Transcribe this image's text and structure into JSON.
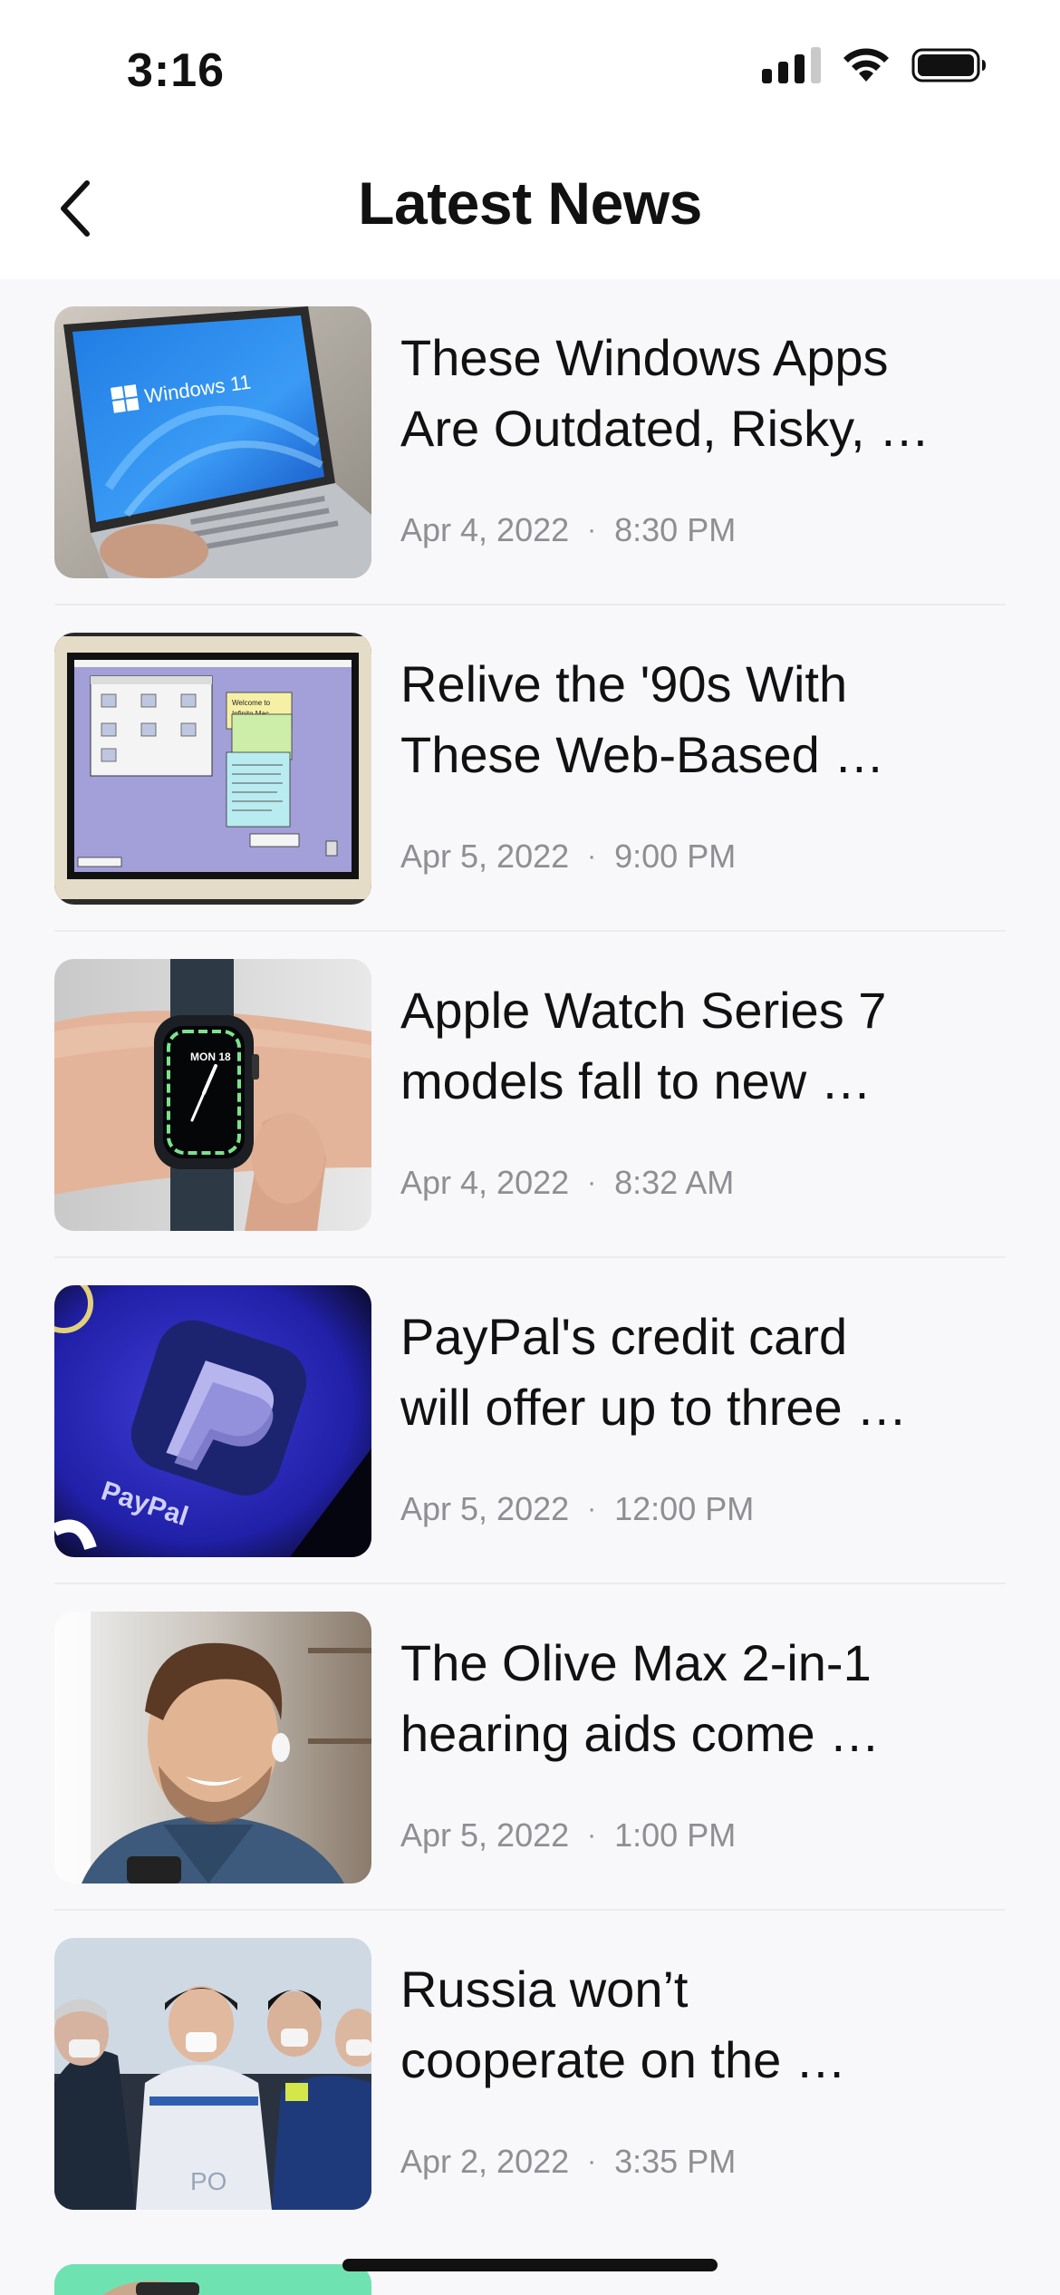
{
  "status_bar": {
    "time": "3:16"
  },
  "header": {
    "title": "Latest News"
  },
  "news": [
    {
      "headline_line1": "These Windows Apps",
      "headline_line2": "Are Outdated, Risky, …",
      "date": "Apr 4, 2022",
      "time": "8:30 PM",
      "image": "windows-laptop-image",
      "image_text": "Windows 11"
    },
    {
      "headline_line1": "Relive the '90s With",
      "headline_line2": "These Web-Based …",
      "date": "Apr 5, 2022",
      "time": "9:00 PM",
      "image": "retro-mac-image",
      "image_text": "Welcome to Infinite Macintosh"
    },
    {
      "headline_line1": "Apple Watch Series 7",
      "headline_line2": "models fall to new …",
      "date": "Apr 4, 2022",
      "time": "8:32 AM",
      "image": "apple-watch-image",
      "image_text": "MON 18"
    },
    {
      "headline_line1": "PayPal's credit card",
      "headline_line2": "will offer up to three …",
      "date": "Apr 5, 2022",
      "time": "12:00 PM",
      "image": "paypal-app-image",
      "image_text": "PayPal"
    },
    {
      "headline_line1": "The Olive Max 2-in-1",
      "headline_line2": "hearing aids come …",
      "date": "Apr 5, 2022",
      "time": "1:00 PM",
      "image": "smiling-man-image"
    },
    {
      "headline_line1": "Russia won’t",
      "headline_line2": "cooperate on the …",
      "date": "Apr 2, 2022",
      "time": "3:35 PM",
      "image": "cosmonauts-image",
      "image_text": "PO"
    }
  ]
}
